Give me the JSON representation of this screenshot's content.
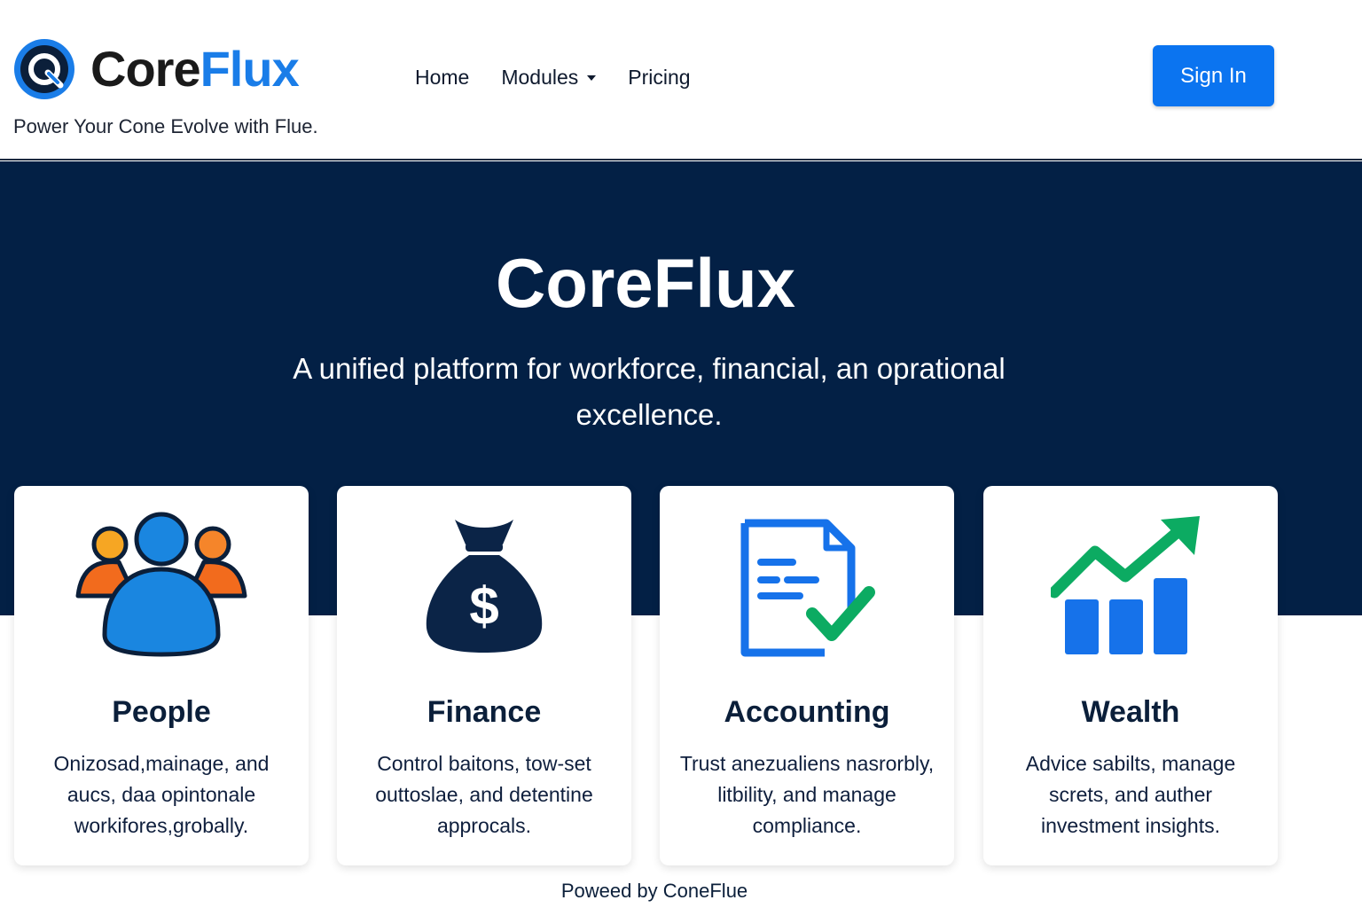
{
  "brand": {
    "name_part1": "Core",
    "name_part2": "Flux",
    "tagline": "Power Your Cone Evolve with Flue.",
    "accent_color": "#1a7de8"
  },
  "nav": {
    "items": [
      "Home",
      "Modules",
      "Pricing"
    ]
  },
  "header": {
    "signin_label": "Sign In"
  },
  "hero": {
    "title": "CoreFlux",
    "subtitle": "A unified platform for workforce, financial, an oprational excellence."
  },
  "cards": [
    {
      "icon": "people-icon",
      "title": "People",
      "desc": "Onizosad,mainage, and aucs, daa opintonale workifores,grobally."
    },
    {
      "icon": "money-bag-icon",
      "title": "Finance",
      "desc": "Control baitons, tow-set outtoslae, and detentine approcals."
    },
    {
      "icon": "document-check-icon",
      "title": "Accounting",
      "desc": "Trust anezualiens nasrorbly, litbility, and manage compliance."
    },
    {
      "icon": "growth-chart-icon",
      "title": "Wealth",
      "desc": "Advice sabilts, manage screts, and auther investment insights."
    }
  ],
  "footer": {
    "text": "Poweed by ConeFlue"
  },
  "colors": {
    "hero_bg": "#032045",
    "button": "#0b74f0",
    "green": "#0cab62"
  }
}
